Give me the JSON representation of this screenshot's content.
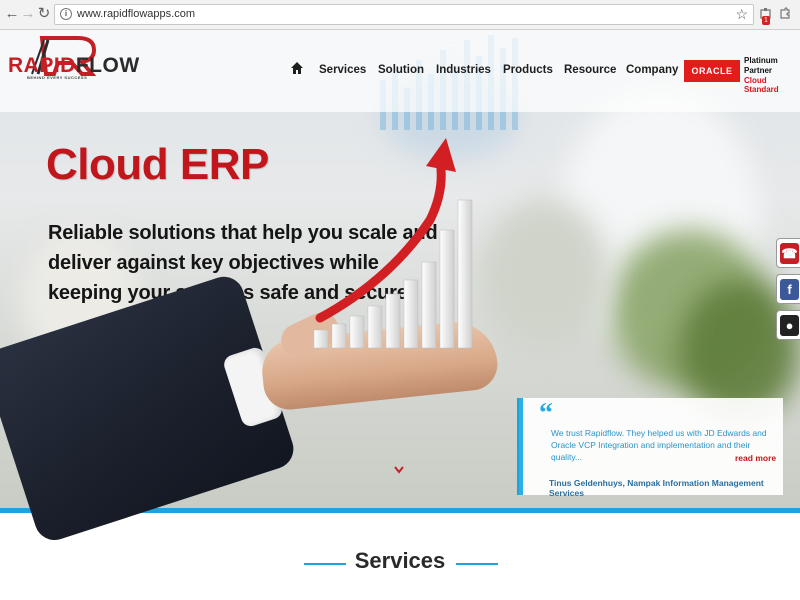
{
  "browser": {
    "url": "www.rapidflowapps.com",
    "back_icon": "back-arrow-icon",
    "forward_icon": "forward-arrow-icon",
    "reload_icon": "reload-icon",
    "extension_badge": "1"
  },
  "brand": {
    "name_part1": "RAPID",
    "name_part2": "FLOW",
    "tagline": "BEHIND EVERY SUCCESS",
    "red": "#c41f24"
  },
  "nav": {
    "items": [
      {
        "label": "Services"
      },
      {
        "label": "Solution"
      },
      {
        "label": "Industries"
      },
      {
        "label": "Products"
      },
      {
        "label": "Resource"
      },
      {
        "label": "Company"
      }
    ]
  },
  "partner": {
    "logo_text": "ORACLE",
    "line1": "Platinum",
    "line2": "Partner",
    "line3": "Cloud Standard"
  },
  "hero": {
    "title": "Cloud ERP",
    "lines": [
      "Reliable solutions that help you scale and",
      "deliver against key objectives while",
      "keeping your systems safe and secure"
    ]
  },
  "testimonial": {
    "quote_mark": "“",
    "text": "We trust Rapidflow. They helped us with JD Edwards and Oracle VCP Integration and implementation and their quality...",
    "read_more": "read more",
    "author": "Tinus Geldenhuys, Nampak Information Management Services"
  },
  "side_buttons": [
    {
      "icon": "phone-icon",
      "color": "#c41f24"
    },
    {
      "icon": "facebook-icon",
      "color": "#3b5998"
    },
    {
      "icon": "chat-icon",
      "color": "#222222"
    }
  ],
  "services": {
    "title": "Services"
  },
  "colors": {
    "accent_blue": "#1fa3dd",
    "brand_red": "#c41f24"
  }
}
